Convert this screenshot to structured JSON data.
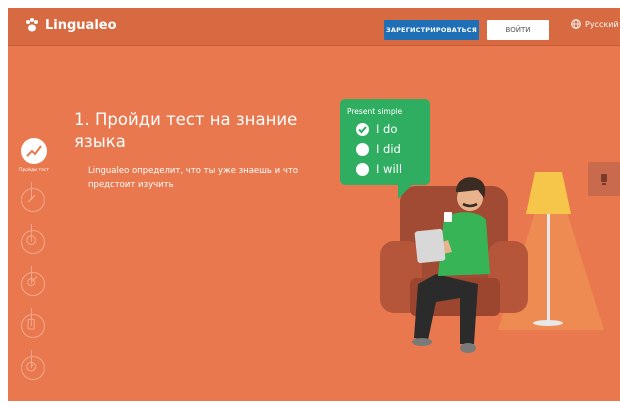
{
  "app": {
    "logo_text": "Lingualeo"
  },
  "header": {
    "register_label": "ЗАРЕГИСТРИРОВАТЬСЯ",
    "login_label": "ВОЙТИ",
    "language": "Русский"
  },
  "hero": {
    "title": "1. Пройди тест на знание языка",
    "description": "Lingualeo определит, что ты уже знаешь и что предстоит изучить"
  },
  "sidebar": {
    "active_label": "Пройди тест",
    "steps": [
      {
        "icon": "test-icon"
      },
      {
        "icon": "compass-icon"
      },
      {
        "icon": "brain-icon"
      },
      {
        "icon": "target-icon"
      },
      {
        "icon": "phone-icon"
      },
      {
        "icon": "timer-icon"
      }
    ]
  },
  "bubble": {
    "title": "Present simple",
    "options": [
      {
        "text": "I do",
        "checked": true
      },
      {
        "text": "I did",
        "checked": false
      },
      {
        "text": "I will",
        "checked": false
      }
    ]
  },
  "colors": {
    "background": "#e9784e",
    "register_button": "#1f6fb7",
    "bubble": "#2fae62"
  }
}
